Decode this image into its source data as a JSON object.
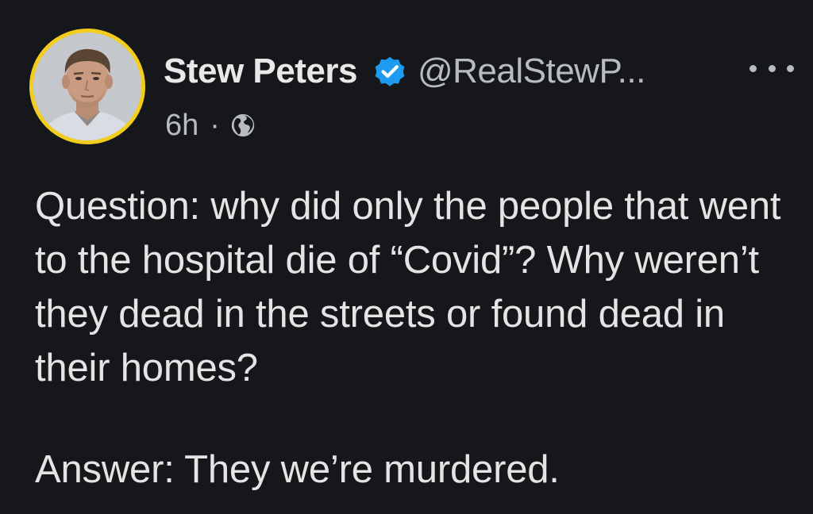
{
  "post": {
    "author": {
      "display_name": "Stew Peters",
      "handle": "@RealStewP...",
      "verified": true,
      "avatar_icon": "avatar-photo",
      "avatar_ring_color": "#f2cd1e"
    },
    "timestamp": "6h",
    "separator": "·",
    "visibility_icon": "globe-icon",
    "more_icon": "more-options-icon",
    "paragraphs": [
      "Question: why did only the people that went to the hospital die of “Covid”? Why weren’t they dead in the streets or found dead in their homes?",
      "Answer: They we’re murdered."
    ]
  },
  "colors": {
    "background": "#16171b",
    "text": "#e4e4e4",
    "muted": "#b8bbbf",
    "verified_badge": "#1d9bf0"
  }
}
